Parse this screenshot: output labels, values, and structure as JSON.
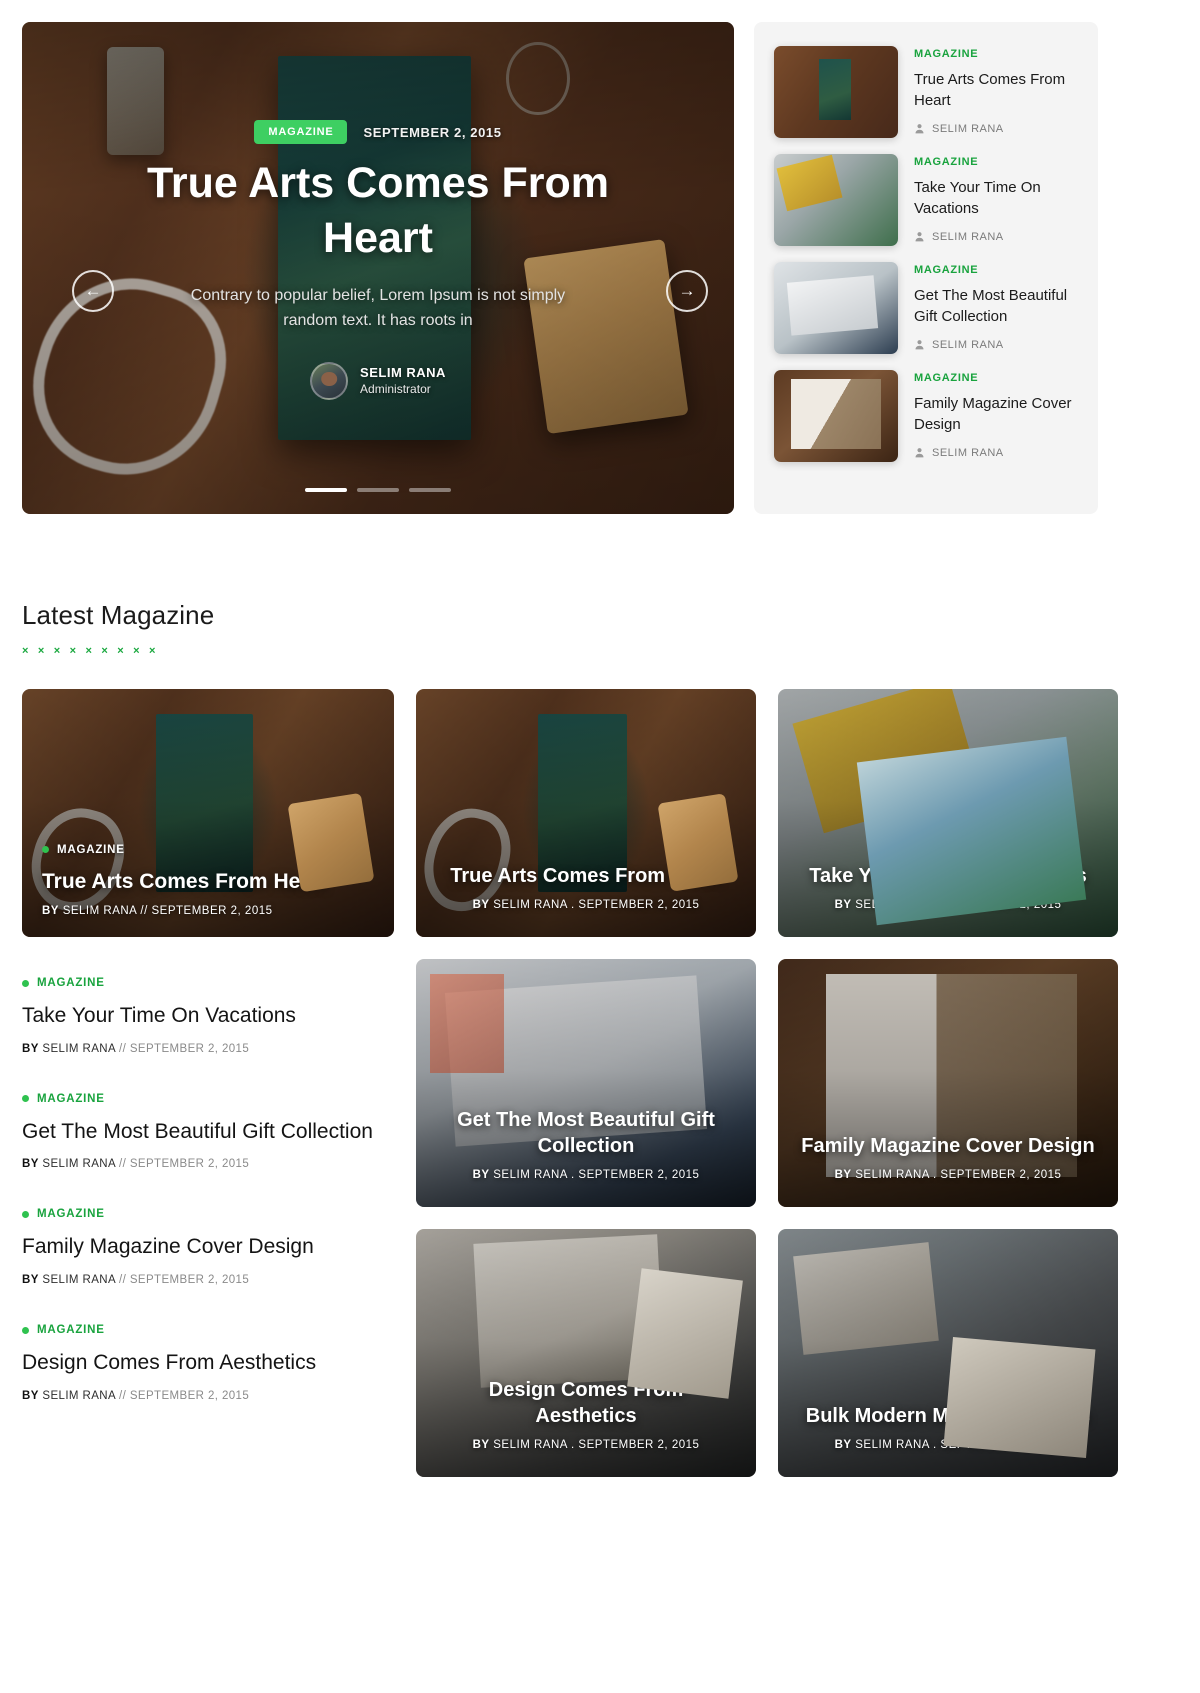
{
  "hero": {
    "badge": "MAGAZINE",
    "date": "SEPTEMBER 2, 2015",
    "title": "True Arts Comes From Heart",
    "description": "Contrary to popular belief, Lorem Ipsum is not simply random text. It has roots in",
    "author_name": "SELIM RANA",
    "author_role": "Administrator",
    "prev_icon": "arrow-left-icon",
    "next_icon": "arrow-right-icon",
    "prev_glyph": "←",
    "next_glyph": "→",
    "slides": 3,
    "active_slide": 1,
    "accent_color": "#3ecf62"
  },
  "sidebar": {
    "items": [
      {
        "category": "MAGAZINE",
        "title": "True Arts Comes From Heart",
        "author": "SELIM RANA"
      },
      {
        "category": "MAGAZINE",
        "title": "Take Your Time On Vacations",
        "author": "SELIM RANA"
      },
      {
        "category": "MAGAZINE",
        "title": "Get The Most Beautiful Gift Collection",
        "author": "SELIM RANA"
      },
      {
        "category": "MAGAZINE",
        "title": "Family Magazine Cover Design",
        "author": "SELIM RANA"
      }
    ]
  },
  "section": {
    "title": "Latest Magazine",
    "decoration": "× × × × × × × × ×",
    "accent_color": "#19a33e"
  },
  "cards": {
    "feature": {
      "category": "MAGAZINE",
      "title": "True Arts Comes From Heart",
      "by_label": "BY",
      "author": "SELIM RANA",
      "separator": "//",
      "date": "SEPTEMBER 2, 2015"
    },
    "mid_top": {
      "title": "True Arts Comes From Heart",
      "by_label": "BY",
      "author": "SELIM RANA",
      "separator": ".",
      "date": "SEPTEMBER 2, 2015"
    },
    "right_top": {
      "title": "Take Your Time On Vacations",
      "by_label": "BY",
      "author": "SELIM RANA",
      "separator": ".",
      "date": "SEPTEMBER 2, 2015"
    },
    "mid_middle": {
      "title": "Get The Most Beautiful Gift Collection",
      "by_label": "BY",
      "author": "SELIM RANA",
      "separator": ".",
      "date": "SEPTEMBER 2, 2015"
    },
    "right_middle": {
      "title": "Family Magazine Cover Design",
      "by_label": "BY",
      "author": "SELIM RANA",
      "separator": ".",
      "date": "SEPTEMBER 2, 2015"
    },
    "mid_bottom": {
      "title": "Design Comes From Aesthetics",
      "by_label": "BY",
      "author": "SELIM RANA",
      "separator": ".",
      "date": "SEPTEMBER 2, 2015"
    },
    "right_bottom": {
      "title": "Bulk Modern Magazine Stores",
      "by_label": "BY",
      "author": "SELIM RANA",
      "separator": ".",
      "date": "SEPTEMBER 2, 2015"
    }
  },
  "text_list": [
    {
      "category": "MAGAZINE",
      "title": "Take Your Time On Vacations",
      "by_label": "BY",
      "author": "SELIM RANA",
      "separator": "//",
      "date": "SEPTEMBER 2, 2015"
    },
    {
      "category": "MAGAZINE",
      "title": "Get The Most Beautiful Gift Collection",
      "by_label": "BY",
      "author": "SELIM RANA",
      "separator": "//",
      "date": "SEPTEMBER 2, 2015"
    },
    {
      "category": "MAGAZINE",
      "title": "Family Magazine Cover Design",
      "by_label": "BY",
      "author": "SELIM RANA",
      "separator": "//",
      "date": "SEPTEMBER 2, 2015"
    },
    {
      "category": "MAGAZINE",
      "title": "Design Comes From Aesthetics",
      "by_label": "BY",
      "author": "SELIM RANA",
      "separator": "//",
      "date": "SEPTEMBER 2, 2015"
    }
  ]
}
